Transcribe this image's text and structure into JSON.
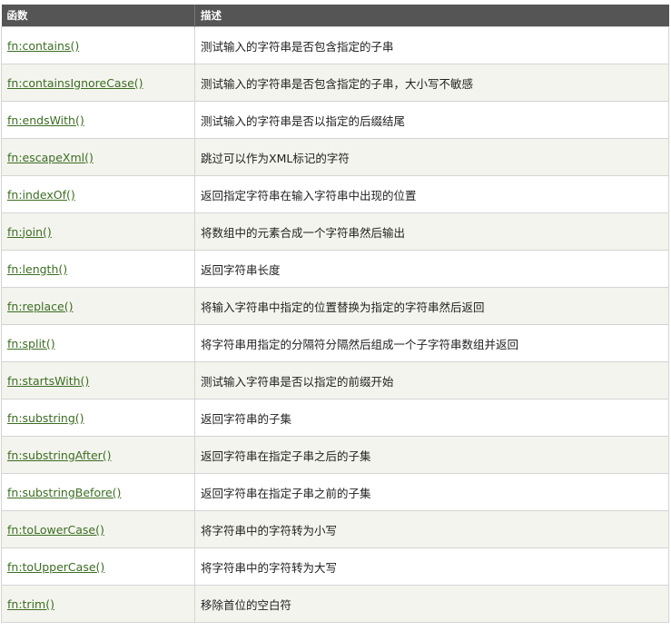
{
  "table": {
    "headers": [
      "函数",
      "描述"
    ],
    "rows": [
      {
        "fn": "fn:contains()",
        "desc": "测试输入的字符串是否包含指定的子串"
      },
      {
        "fn": "fn:containsIgnoreCase()",
        "desc": "测试输入的字符串是否包含指定的子串，大小写不敏感"
      },
      {
        "fn": "fn:endsWith()",
        "desc": "测试输入的字符串是否以指定的后缀结尾"
      },
      {
        "fn": "fn:escapeXml()",
        "desc": "跳过可以作为XML标记的字符"
      },
      {
        "fn": "fn:indexOf()",
        "desc": "返回指定字符串在输入字符串中出现的位置"
      },
      {
        "fn": "fn:join()",
        "desc": "将数组中的元素合成一个字符串然后输出"
      },
      {
        "fn": "fn:length()",
        "desc": "返回字符串长度"
      },
      {
        "fn": "fn:replace()",
        "desc": "将输入字符串中指定的位置替换为指定的字符串然后返回"
      },
      {
        "fn": "fn:split()",
        "desc": "将字符串用指定的分隔符分隔然后组成一个子字符串数组并返回"
      },
      {
        "fn": "fn:startsWith()",
        "desc": "测试输入字符串是否以指定的前缀开始"
      },
      {
        "fn": "fn:substring()",
        "desc": "返回字符串的子集"
      },
      {
        "fn": "fn:substringAfter()",
        "desc": "返回字符串在指定子串之后的子集"
      },
      {
        "fn": "fn:substringBefore()",
        "desc": "返回字符串在指定子串之前的子集"
      },
      {
        "fn": "fn:toLowerCase()",
        "desc": "将字符串中的字符转为小写"
      },
      {
        "fn": "fn:toUpperCase()",
        "desc": "将字符串中的字符转为大写"
      },
      {
        "fn": "fn:trim()",
        "desc": "移除首位的空白符"
      }
    ]
  }
}
